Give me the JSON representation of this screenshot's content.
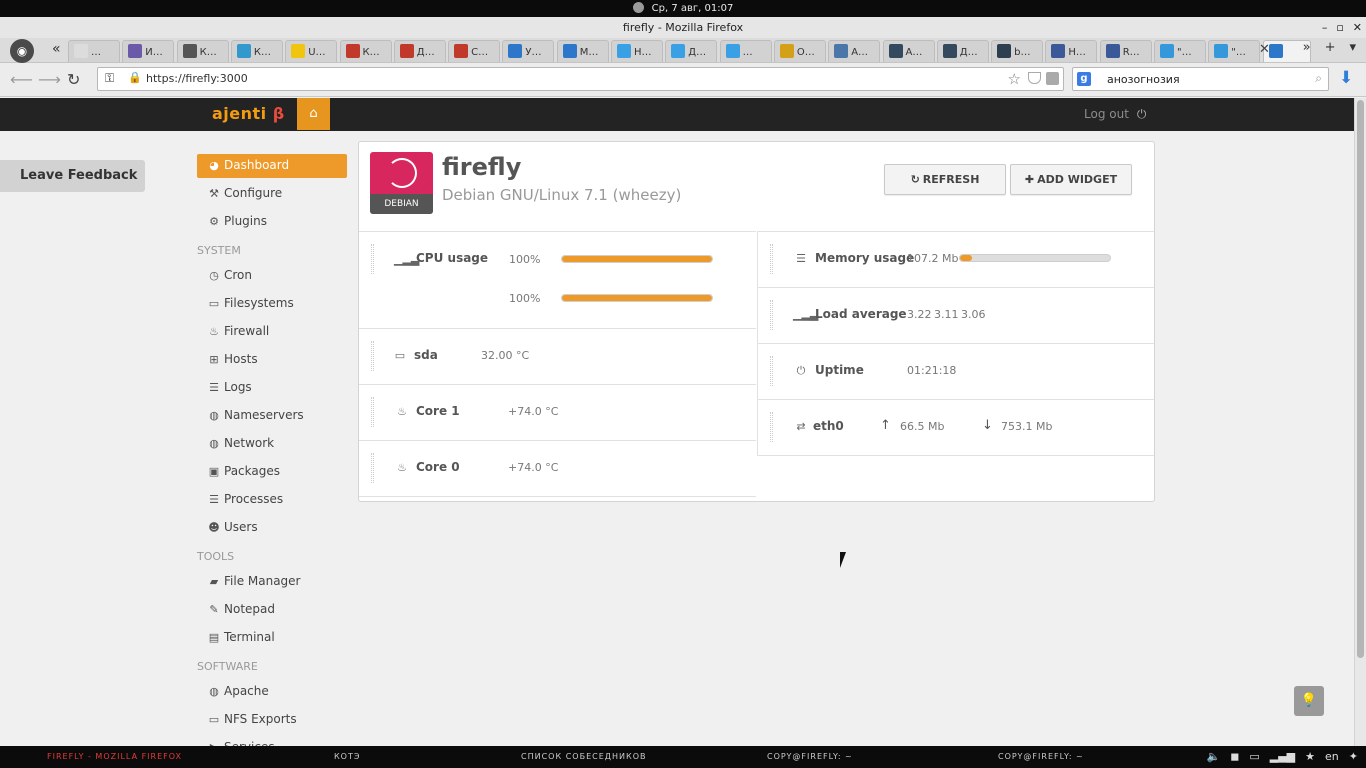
{
  "system": {
    "clock": "Ср, 7 авг, 01:07"
  },
  "window": {
    "title": "firefly - Mozilla Firefox",
    "controls": [
      "–",
      "▫",
      "✕"
    ]
  },
  "tabs": [
    {
      "label": "…",
      "color": "#dcdcdc"
    },
    {
      "label": "И…",
      "color": "#6b5aa8"
    },
    {
      "label": "К…",
      "color": "#555555"
    },
    {
      "label": "К…",
      "color": "#3399cc"
    },
    {
      "label": "U…",
      "color": "#f1c40f"
    },
    {
      "label": "К…",
      "color": "#c0392b"
    },
    {
      "label": "Д…",
      "color": "#c0392b"
    },
    {
      "label": "С…",
      "color": "#c0392b"
    },
    {
      "label": "У…",
      "color": "#2c77c9"
    },
    {
      "label": "М…",
      "color": "#2c77c9"
    },
    {
      "label": "Н…",
      "color": "#3aa0e6"
    },
    {
      "label": "Д…",
      "color": "#3aa0e6"
    },
    {
      "label": "…",
      "color": "#3aa0e6"
    },
    {
      "label": "О…",
      "color": "#d4a017"
    },
    {
      "label": "А…",
      "color": "#4a76a8"
    },
    {
      "label": "А…",
      "color": "#34495e"
    },
    {
      "label": "Д…",
      "color": "#34495e"
    },
    {
      "label": "b…",
      "color": "#2c3e50"
    },
    {
      "label": "Н…",
      "color": "#3b5998"
    },
    {
      "label": "R…",
      "color": "#3b5998"
    },
    {
      "label": "\"…",
      "color": "#3498db"
    },
    {
      "label": "\"…",
      "color": "#3498db"
    },
    {
      "label": "",
      "color": "#2c77c9"
    }
  ],
  "nav": {
    "url": "https://firefly:3000",
    "search_query": "анозогнозия",
    "search_engine_letter": "g"
  },
  "ajenti": {
    "logo_text": "ajenti",
    "logo_beta": "β",
    "logout": "Log out",
    "feedback": "Leave Feedback"
  },
  "sidebar": {
    "top_items": [
      {
        "label": "Dashboard",
        "icon": "dashboard-icon",
        "glyph": "◕",
        "active": true
      },
      {
        "label": "Configure",
        "icon": "wrench-icon",
        "glyph": "⚒",
        "active": false
      },
      {
        "label": "Plugins",
        "icon": "cogs-icon",
        "glyph": "⚙",
        "active": false
      }
    ],
    "sections": [
      {
        "title": "SYSTEM",
        "items": [
          {
            "label": "Cron",
            "icon": "clock-icon",
            "glyph": "◷"
          },
          {
            "label": "Filesystems",
            "icon": "hdd-icon",
            "glyph": "▭"
          },
          {
            "label": "Firewall",
            "icon": "fire-icon",
            "glyph": "♨"
          },
          {
            "label": "Hosts",
            "icon": "sitemap-icon",
            "glyph": "⊞"
          },
          {
            "label": "Logs",
            "icon": "list-icon",
            "glyph": "☰"
          },
          {
            "label": "Nameservers",
            "icon": "globe-icon",
            "glyph": "◍"
          },
          {
            "label": "Network",
            "icon": "globe-icon",
            "glyph": "◍"
          },
          {
            "label": "Packages",
            "icon": "gift-icon",
            "glyph": "▣"
          },
          {
            "label": "Processes",
            "icon": "list-icon",
            "glyph": "☰"
          },
          {
            "label": "Users",
            "icon": "group-icon",
            "glyph": "☻"
          }
        ]
      },
      {
        "title": "TOOLS",
        "items": [
          {
            "label": "File Manager",
            "icon": "folder-icon",
            "glyph": "▰"
          },
          {
            "label": "Notepad",
            "icon": "edit-icon",
            "glyph": "✎"
          },
          {
            "label": "Terminal",
            "icon": "terminal-icon",
            "glyph": "▤"
          }
        ]
      },
      {
        "title": "SOFTWARE",
        "items": [
          {
            "label": "Apache",
            "icon": "globe-icon",
            "glyph": "◍"
          },
          {
            "label": "NFS Exports",
            "icon": "hdd-icon",
            "glyph": "▭"
          },
          {
            "label": "Services",
            "icon": "play-icon",
            "glyph": "▶"
          }
        ]
      }
    ]
  },
  "host": {
    "name": "firefly",
    "os": "Debian GNU/Linux 7.1 (wheezy)",
    "badge": "DEBIAN"
  },
  "buttons": {
    "refresh": "REFRESH",
    "add_widget": "ADD WIDGET"
  },
  "widgets": {
    "cpu": {
      "title": "CPU usage",
      "rows": [
        {
          "value": "100%",
          "fraction": 1.0
        },
        {
          "value": "100%",
          "fraction": 1.0
        }
      ]
    },
    "sda": {
      "title": "sda",
      "value": "32.00 °C"
    },
    "core1": {
      "title": "Core 1",
      "value": "+74.0 °C"
    },
    "core0": {
      "title": "Core 0",
      "value": "+74.0 °C"
    },
    "memory": {
      "title": "Memory usage",
      "value": "107.2 Mb",
      "fraction": 0.08
    },
    "load": {
      "title": "Load average",
      "values": [
        "3.22",
        "3.11",
        "3.06"
      ]
    },
    "uptime": {
      "title": "Uptime",
      "value": "01:21:18"
    },
    "eth0": {
      "title": "eth0",
      "up": "66.5 Mb",
      "down": "753.1 Mb"
    }
  },
  "taskbar": {
    "items": [
      "FIREFLY - MOZILLA FIREFOX",
      "КОТЭ",
      "СПИСОК СОБЕСЕДНИКОВ",
      "COPY@FIREFLY: ~",
      "COPY@FIREFLY: ~"
    ],
    "lang": "en"
  },
  "colors": {
    "accent": "#ee9a2a",
    "debian": "#d7275e",
    "header": "#232323"
  }
}
